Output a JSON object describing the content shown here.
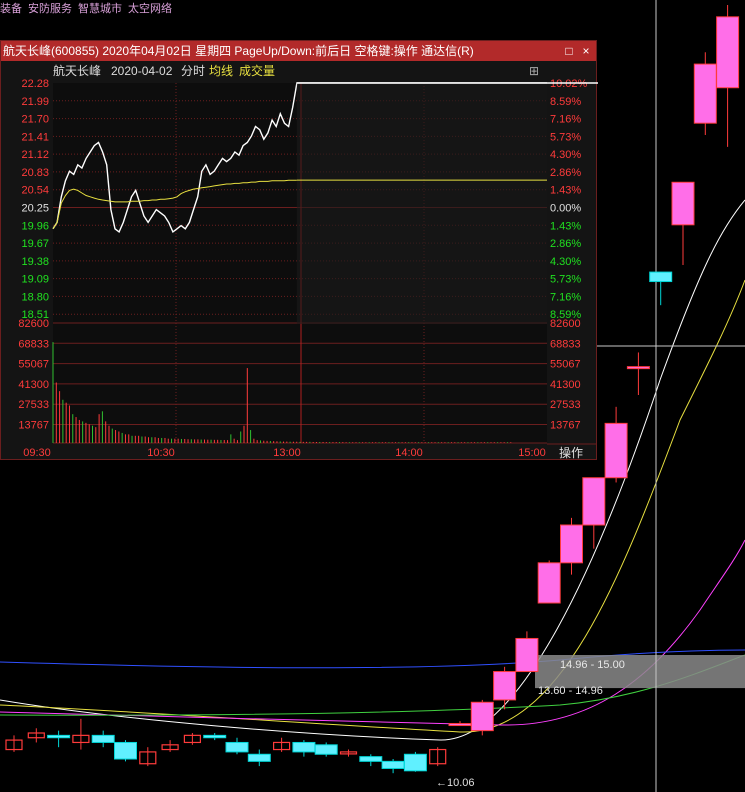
{
  "topbar": {
    "items": [
      "装备",
      "安防服务",
      "智慧城市",
      "太空网络"
    ]
  },
  "window": {
    "title": "航天长峰(600855) 2020年04月02日 星期四 PageUp/Down:前后日 空格键:操作 通达信(R)",
    "maximize_icon": "□",
    "close_icon": "×"
  },
  "info": {
    "name": "航天长峰",
    "date": "2020-04-02",
    "mode": "分时",
    "avg_label": "均线",
    "vol_label": "成交量",
    "settings_icon": "⊞",
    "minus_icon": "⊟"
  },
  "colors": {
    "up": "#ff3b3b",
    "down": "#00d8d8",
    "price_line": "#ffffff",
    "avg_line": "#e8e040",
    "vol": "#ff3b3b",
    "grid": "#6b1e1e",
    "pink": "#ff6ee8",
    "cyan": "#60f0ff"
  },
  "action_button": "操作",
  "chart_data": {
    "type": "line",
    "price_ticks": [
      "22.28",
      "21.99",
      "21.70",
      "21.41",
      "21.12",
      "20.83",
      "20.54",
      "20.25",
      "19.96",
      "19.67",
      "19.38",
      "19.09",
      "18.80",
      "18.51"
    ],
    "pct_ticks": [
      "10.02%",
      "8.59%",
      "7.16%",
      "5.73%",
      "4.30%",
      "2.86%",
      "1.43%",
      "0.00%",
      "1.43%",
      "2.86%",
      "4.30%",
      "5.73%",
      "7.16%",
      "8.59%"
    ],
    "vol_ticks": [
      "82600",
      "68833",
      "55067",
      "41300",
      "27533",
      "13767"
    ],
    "time_ticks": [
      "09:30",
      "10:30",
      "13:00",
      "14:00",
      "15:00"
    ],
    "ylim": [
      18.51,
      22.28
    ],
    "prev_close": 20.25,
    "price": [
      20.0,
      20.1,
      20.5,
      20.75,
      20.9,
      20.85,
      21.0,
      20.95,
      21.1,
      21.2,
      21.3,
      21.35,
      21.2,
      21.0,
      20.3,
      20.0,
      19.95,
      20.1,
      20.3,
      20.5,
      20.6,
      20.4,
      20.2,
      20.1,
      20.2,
      20.3,
      20.25,
      20.2,
      20.1,
      19.95,
      20.0,
      20.05,
      20.0,
      20.1,
      20.3,
      20.5,
      20.9,
      21.0,
      20.85,
      20.9,
      21.0,
      21.1,
      21.05,
      21.1,
      21.2,
      21.15,
      21.3,
      21.35,
      21.45,
      21.6,
      21.55,
      21.4,
      21.5,
      21.7,
      21.6,
      21.8,
      21.65,
      21.6,
      21.9,
      22.28,
      22.28,
      22.28,
      22.28,
      22.28,
      22.28,
      22.28,
      22.28,
      22.28,
      22.28,
      22.28,
      22.28,
      22.28,
      22.28,
      22.28,
      22.28,
      22.28,
      22.28,
      22.28,
      22.28,
      22.28,
      22.28,
      22.28,
      22.28,
      22.28,
      22.28,
      22.28,
      22.28,
      22.28,
      22.28,
      22.28,
      22.28,
      22.28,
      22.28,
      22.28,
      22.28,
      22.28,
      22.28,
      22.28,
      22.28,
      22.28,
      22.28,
      22.28,
      22.28,
      22.28,
      22.28,
      22.28,
      22.28,
      22.28,
      22.28,
      22.28,
      22.28,
      22.28,
      22.28,
      22.28,
      22.28,
      22.28,
      22.28,
      22.28,
      22.28,
      22.28,
      22.28,
      22.28,
      22.28,
      22.28,
      22.28,
      22.28,
      22.28,
      22.28,
      22.28,
      22.28,
      22.28,
      22.28,
      22.28,
      22.28,
      22.28,
      22.28,
      22.28,
      22.28,
      22.28,
      22.28,
      22.28,
      22.28,
      22.28,
      22.28
    ],
    "avg": [
      20.0,
      20.1,
      20.4,
      20.52,
      20.6,
      20.62,
      20.6,
      20.56,
      20.52,
      20.5,
      20.48,
      20.46,
      20.45,
      20.44,
      20.43,
      20.42,
      20.42,
      20.42,
      20.42,
      20.43,
      20.43,
      20.43,
      20.44,
      20.44,
      20.45,
      20.45,
      20.46,
      20.46,
      20.47,
      20.48,
      20.5,
      20.55,
      20.58,
      20.6,
      20.62,
      20.63,
      20.64,
      20.65,
      20.66,
      20.67,
      20.68,
      20.69,
      20.7,
      20.7,
      20.71,
      20.71,
      20.72,
      20.72,
      20.73,
      20.73,
      20.74,
      20.74,
      20.74,
      20.75,
      20.75,
      20.75,
      20.75,
      20.76,
      20.76,
      20.76
    ],
    "volume": [
      70000,
      42000,
      36000,
      30000,
      28000,
      26000,
      20000,
      18000,
      16000,
      15000,
      14000,
      13000,
      12000,
      11000,
      20000,
      22000,
      15000,
      12000,
      10000,
      9000,
      8000,
      7000,
      6000,
      6000,
      5000,
      5000,
      5000,
      4500,
      4500,
      4000,
      4000,
      4000,
      3500,
      3500,
      3500,
      3000,
      3000,
      3000,
      3000,
      2800,
      2800,
      2600,
      2600,
      2500,
      2500,
      2400,
      2400,
      2300,
      2300,
      2200,
      2200,
      2100,
      2100,
      2000,
      6000,
      3000,
      2000,
      8000,
      12000,
      52000,
      9000,
      3000,
      2000,
      1800,
      1600,
      1500,
      1400,
      1300,
      1200,
      1100,
      1000,
      1000,
      900,
      900,
      900,
      800,
      800,
      800,
      800,
      700,
      700,
      700,
      700,
      600,
      600,
      600,
      600,
      600,
      600,
      500,
      500,
      500,
      500,
      500,
      500,
      500,
      500,
      500,
      500,
      500,
      500,
      500,
      500,
      500,
      500,
      500,
      500,
      500,
      500,
      500,
      500,
      500,
      500,
      500,
      500,
      500,
      500,
      500,
      500,
      500,
      500,
      500,
      500,
      500,
      500,
      500,
      500,
      500,
      500,
      500,
      500,
      500,
      500,
      500,
      500,
      500,
      500,
      500,
      500,
      500
    ]
  },
  "background": {
    "zones": [
      "14.96 - 15.00",
      "13.60 - 14.96"
    ],
    "low_label": "←10.06",
    "candles": [
      {
        "o": 11.0,
        "c": 11.4,
        "h": 11.6,
        "l": 10.9
      },
      {
        "o": 11.5,
        "c": 11.7,
        "h": 11.9,
        "l": 11.3
      },
      {
        "o": 11.6,
        "c": 11.5,
        "h": 11.8,
        "l": 11.1
      },
      {
        "o": 11.3,
        "c": 11.6,
        "h": 12.3,
        "l": 11.0
      },
      {
        "o": 11.6,
        "c": 11.3,
        "h": 11.8,
        "l": 11.1
      },
      {
        "o": 11.3,
        "c": 10.6,
        "h": 11.4,
        "l": 10.5
      },
      {
        "o": 10.4,
        "c": 10.9,
        "h": 11.1,
        "l": 10.3
      },
      {
        "o": 11.0,
        "c": 11.2,
        "h": 11.4,
        "l": 10.9
      },
      {
        "o": 11.3,
        "c": 11.6,
        "h": 11.7,
        "l": 11.2
      },
      {
        "o": 11.6,
        "c": 11.5,
        "h": 11.7,
        "l": 11.4
      },
      {
        "o": 11.3,
        "c": 10.9,
        "h": 11.5,
        "l": 10.8
      },
      {
        "o": 10.8,
        "c": 10.5,
        "h": 11.0,
        "l": 10.3
      },
      {
        "o": 11.0,
        "c": 11.3,
        "h": 11.5,
        "l": 10.9
      },
      {
        "o": 11.3,
        "c": 10.9,
        "h": 11.4,
        "l": 10.7
      },
      {
        "o": 11.2,
        "c": 10.8,
        "h": 11.3,
        "l": 10.7
      },
      {
        "o": 10.9,
        "c": 10.9,
        "h": 11.0,
        "l": 10.7
      },
      {
        "o": 10.7,
        "c": 10.5,
        "h": 10.8,
        "l": 10.3
      },
      {
        "o": 10.5,
        "c": 10.2,
        "h": 10.6,
        "l": 10.0
      },
      {
        "o": 10.8,
        "c": 10.1,
        "h": 10.9,
        "l": 10.06
      },
      {
        "o": 10.4,
        "c": 11.0,
        "h": 11.1,
        "l": 10.3
      },
      {
        "o": 12.1,
        "c": 12.1,
        "h": 12.2,
        "l": 12.0
      },
      {
        "o": 11.8,
        "c": 13.0,
        "h": 13.1,
        "l": 11.6
      },
      {
        "o": 13.1,
        "c": 14.3,
        "h": 14.5,
        "l": 12.7
      },
      {
        "o": 14.3,
        "c": 15.7,
        "h": 16.0,
        "l": 14.3
      },
      {
        "o": 17.2,
        "c": 18.9,
        "h": 19.0,
        "l": 17.2
      },
      {
        "o": 18.9,
        "c": 20.5,
        "h": 20.8,
        "l": 18.4
      },
      {
        "o": 20.5,
        "c": 22.5,
        "h": 22.5,
        "l": 19.5
      },
      {
        "o": 22.5,
        "c": 24.8,
        "h": 25.5,
        "l": 22.3
      },
      {
        "o": 27.2,
        "c": 27.2,
        "h": 27.8,
        "l": 26.0
      },
      {
        "o": 31.2,
        "c": 30.8,
        "h": 31.2,
        "l": 29.8
      },
      {
        "o": 33.2,
        "c": 35.0,
        "h": 35.0,
        "l": 31.5
      },
      {
        "o": 37.5,
        "c": 40.0,
        "h": 40.5,
        "l": 37.0
      },
      {
        "o": 39.0,
        "c": 42.0,
        "h": 42.5,
        "l": 36.5
      }
    ]
  }
}
